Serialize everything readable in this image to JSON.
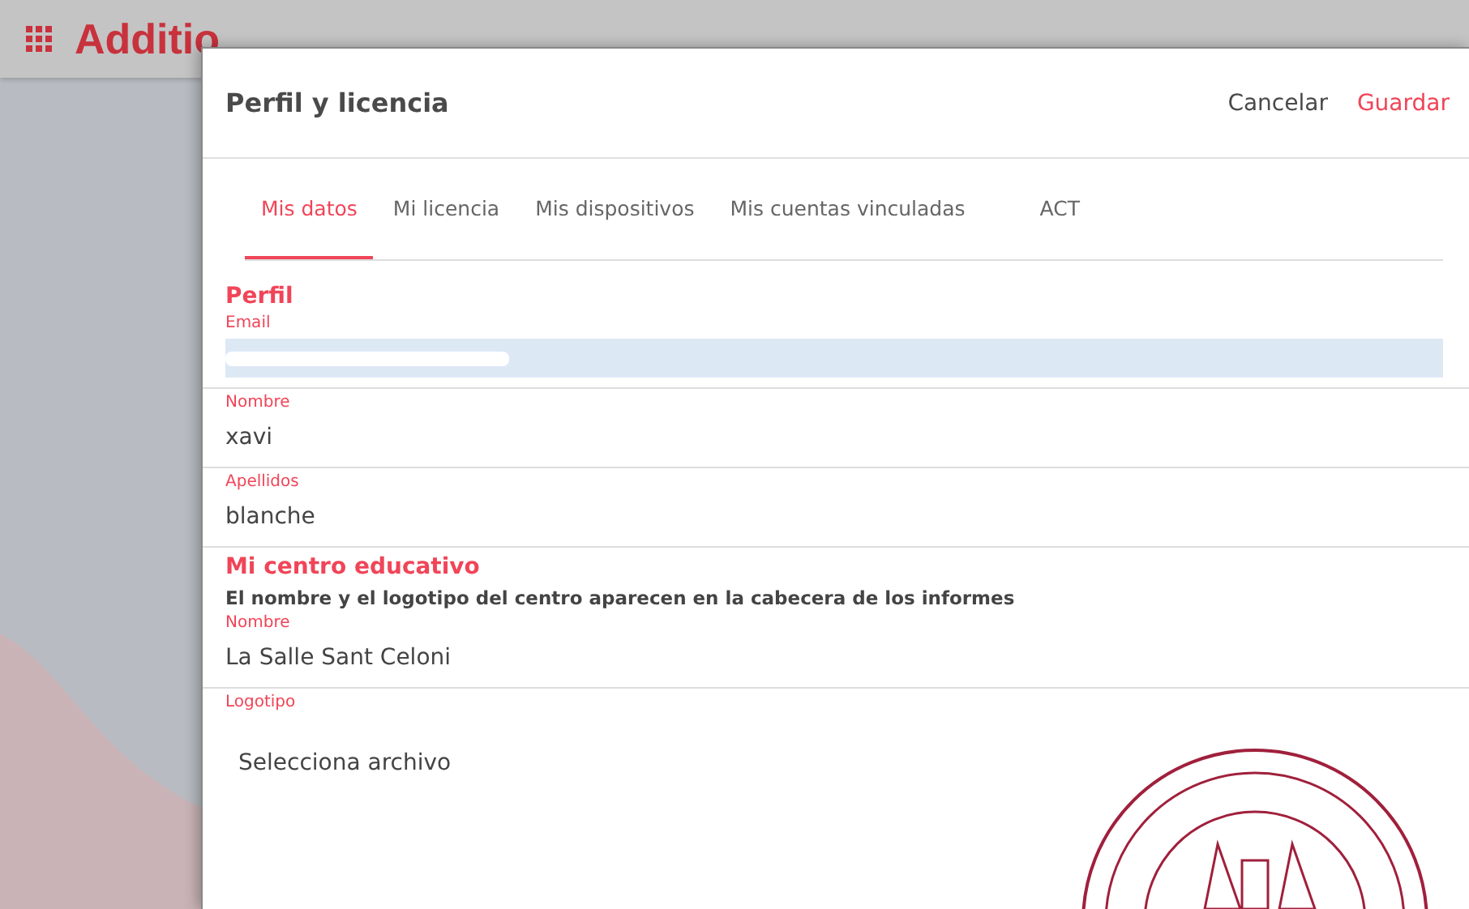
{
  "app_bar": {
    "brand": "Additio"
  },
  "dialog": {
    "title": "Perfil y licencia",
    "actions": [
      {
        "label": "Cancelar",
        "kind": "secondary"
      },
      {
        "label": "Guardar",
        "kind": "primary"
      }
    ]
  },
  "tabs": [
    {
      "label": "Mis datos",
      "selected": true
    },
    {
      "label": "Mi licencia",
      "selected": false
    },
    {
      "label": "Mis dispositivos",
      "selected": false
    },
    {
      "label": "Mis cuentas vinculadas",
      "selected": false
    },
    {
      "label": "ACT",
      "selected": false
    }
  ],
  "sections": [
    {
      "title": "Perfil",
      "fields": [
        {
          "label": "Email",
          "kind": "redacted",
          "highlighted": true
        },
        {
          "label": "Nombre",
          "kind": "text",
          "value": "xavi"
        },
        {
          "label": "Apellidos",
          "kind": "text",
          "value": "blanche"
        }
      ]
    },
    {
      "title": "Mi centro educativo",
      "subtitle": "El nombre y el logotipo del centro aparecen en la cabecera de los informes",
      "fields": [
        {
          "label": "Nombre",
          "kind": "text",
          "value": "La Salle Sant Celoni"
        },
        {
          "label": "Logotipo",
          "kind": "file",
          "value": "Selecciona archivo"
        }
      ]
    }
  ]
}
